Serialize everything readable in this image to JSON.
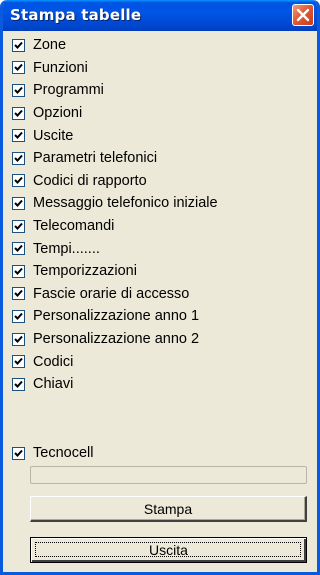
{
  "window": {
    "title": "Stampa tabelle",
    "accent_color": "#0054e3",
    "close_icon": "close-icon"
  },
  "items": [
    {
      "label": "Zone",
      "checked": true
    },
    {
      "label": "Funzioni",
      "checked": true
    },
    {
      "label": "Programmi",
      "checked": true
    },
    {
      "label": "Opzioni",
      "checked": true
    },
    {
      "label": "Uscite",
      "checked": true
    },
    {
      "label": "Parametri telefonici",
      "checked": true
    },
    {
      "label": "Codici di rapporto",
      "checked": true
    },
    {
      "label": "Messaggio telefonico iniziale",
      "checked": true
    },
    {
      "label": "Telecomandi",
      "checked": true
    },
    {
      "label": "Tempi.......",
      "checked": true
    },
    {
      "label": "Temporizzazioni",
      "checked": true
    },
    {
      "label": "Fascie orarie di accesso",
      "checked": true
    },
    {
      "label": "Personalizzazione anno 1",
      "checked": true
    },
    {
      "label": "Personalizzazione anno 2",
      "checked": true
    },
    {
      "label": "Codici",
      "checked": true
    },
    {
      "label": "Chiavi",
      "checked": true
    }
  ],
  "tecnocell": {
    "label": "Tecnocell",
    "checked": true
  },
  "progress": {
    "value": 0
  },
  "buttons": {
    "print_label": "Stampa",
    "exit_label": "Uscita"
  }
}
